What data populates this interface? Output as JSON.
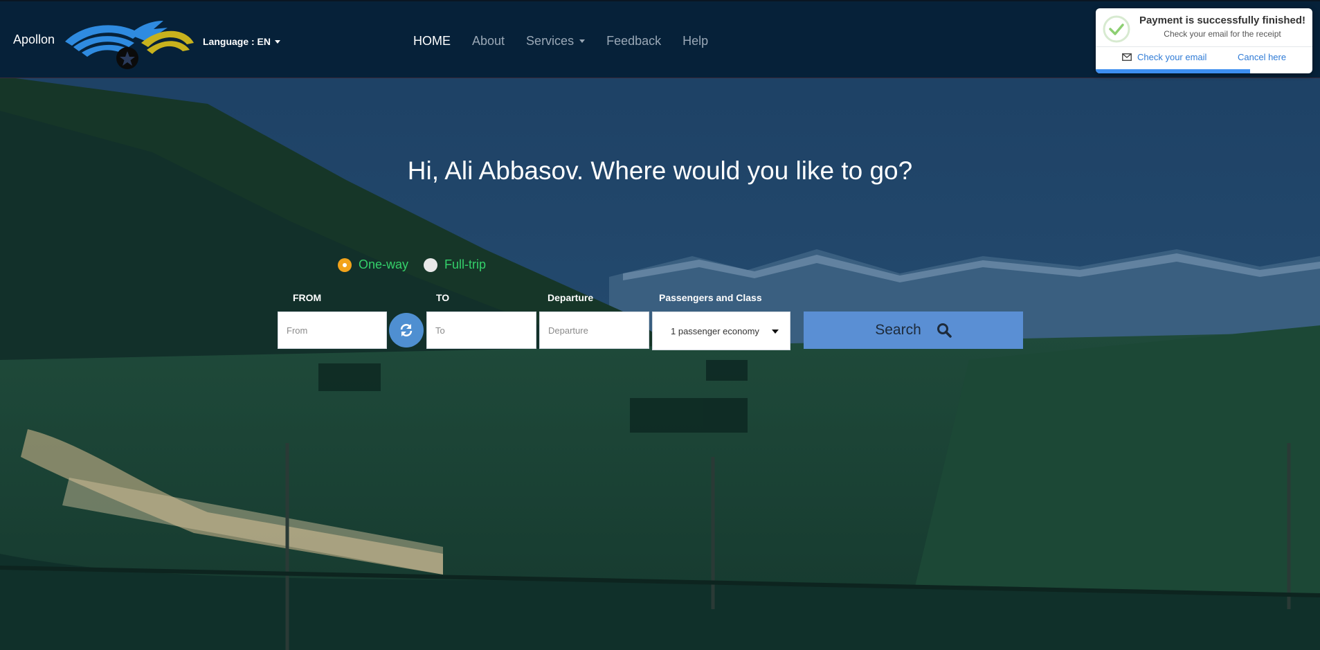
{
  "brand": {
    "name": "Apollon"
  },
  "language": {
    "label": "Language : EN"
  },
  "nav": {
    "items": [
      {
        "label": "HOME",
        "active": true
      },
      {
        "label": "About"
      },
      {
        "label": "Services",
        "has_dropdown": true
      },
      {
        "label": "Feedback"
      },
      {
        "label": "Help"
      }
    ]
  },
  "hero": {
    "headline": "Hi, Ali Abbasov. Where would you like to go?"
  },
  "trip_type": {
    "options": [
      {
        "label": "One-way",
        "selected": true
      },
      {
        "label": "Full-trip",
        "selected": false
      }
    ]
  },
  "search_form": {
    "from_label": "FROM",
    "from_placeholder": "From",
    "to_label": "TO",
    "to_placeholder": "To",
    "departure_label": "Departure",
    "departure_placeholder": "Departure",
    "passengers_label": "Passengers and Class",
    "passengers_value": "1 passenger economy",
    "search_label": "Search"
  },
  "toast": {
    "title": "Payment is successfully finished!",
    "subtitle": "Check your email for the receipt",
    "check_email_label": "Check your email",
    "cancel_label": "Cancel here"
  },
  "colors": {
    "navbar": "#062139",
    "accent_green": "#34d06a",
    "radio_selected": "#f2a31b",
    "search_button": "#5a8fd4",
    "toast_link": "#2f7bd6"
  }
}
